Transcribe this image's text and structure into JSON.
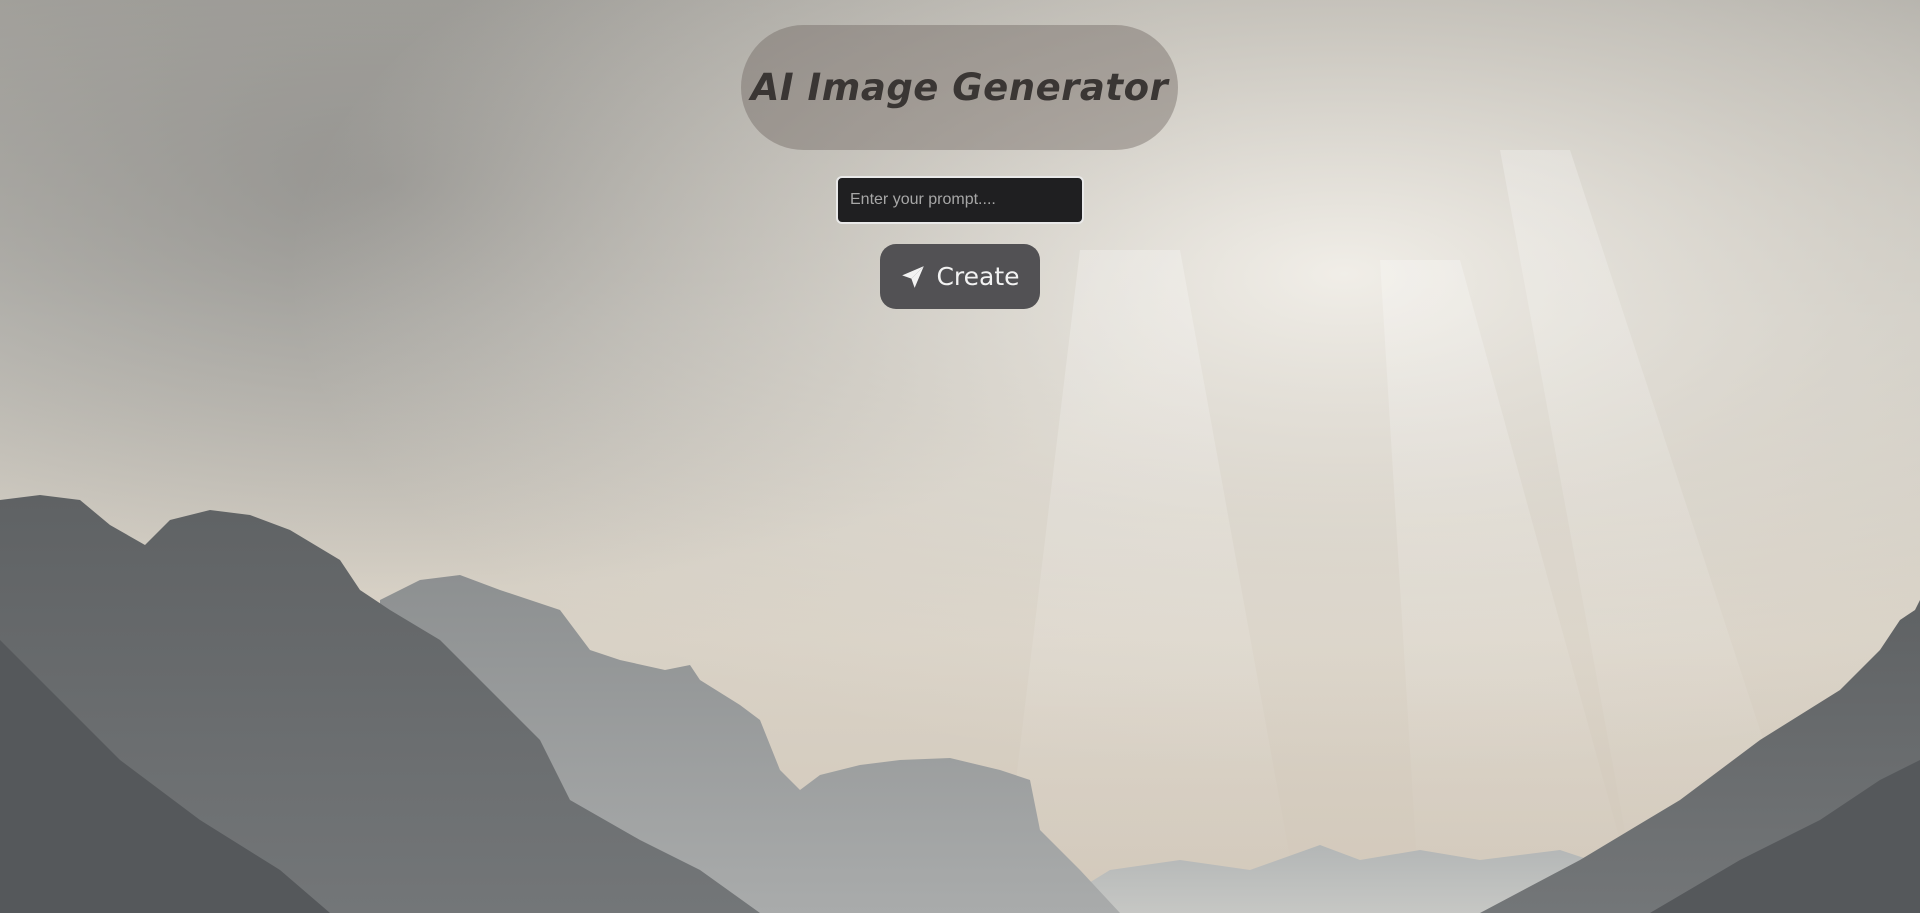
{
  "header": {
    "title": "AI Image Generator"
  },
  "prompt": {
    "placeholder": "Enter your prompt....",
    "value": ""
  },
  "actions": {
    "create_label": "Create",
    "create_icon": "send-icon"
  },
  "colors": {
    "input_background": "#1f1f21",
    "button_background": "#525154",
    "title_text": "#3a3634"
  }
}
